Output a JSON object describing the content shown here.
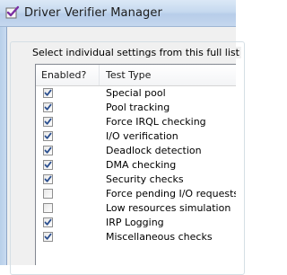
{
  "window": {
    "title": "Driver Verifier Manager"
  },
  "group": {
    "caption": "Select individual settings from this full list"
  },
  "list": {
    "columns": [
      "Enabled?",
      "Test Type"
    ],
    "rows": [
      {
        "label": "Special pool",
        "checked": true
      },
      {
        "label": "Pool tracking",
        "checked": true
      },
      {
        "label": "Force IRQL checking",
        "checked": true
      },
      {
        "label": "I/O verification",
        "checked": true
      },
      {
        "label": "Deadlock detection",
        "checked": true
      },
      {
        "label": "DMA checking",
        "checked": true
      },
      {
        "label": "Security checks",
        "checked": true
      },
      {
        "label": "Force pending I/O requests",
        "checked": false
      },
      {
        "label": "Low resources simulation",
        "checked": false
      },
      {
        "label": "IRP Logging",
        "checked": true
      },
      {
        "label": "Miscellaneous checks",
        "checked": true
      }
    ]
  },
  "icons": {
    "app": "driver-verifier-icon",
    "check": "checkmark-icon"
  },
  "colors": {
    "title_gradient_top": "#dbe8f6",
    "client_bg": "#f0f0f0",
    "check_mark": "#2b4f8f"
  }
}
